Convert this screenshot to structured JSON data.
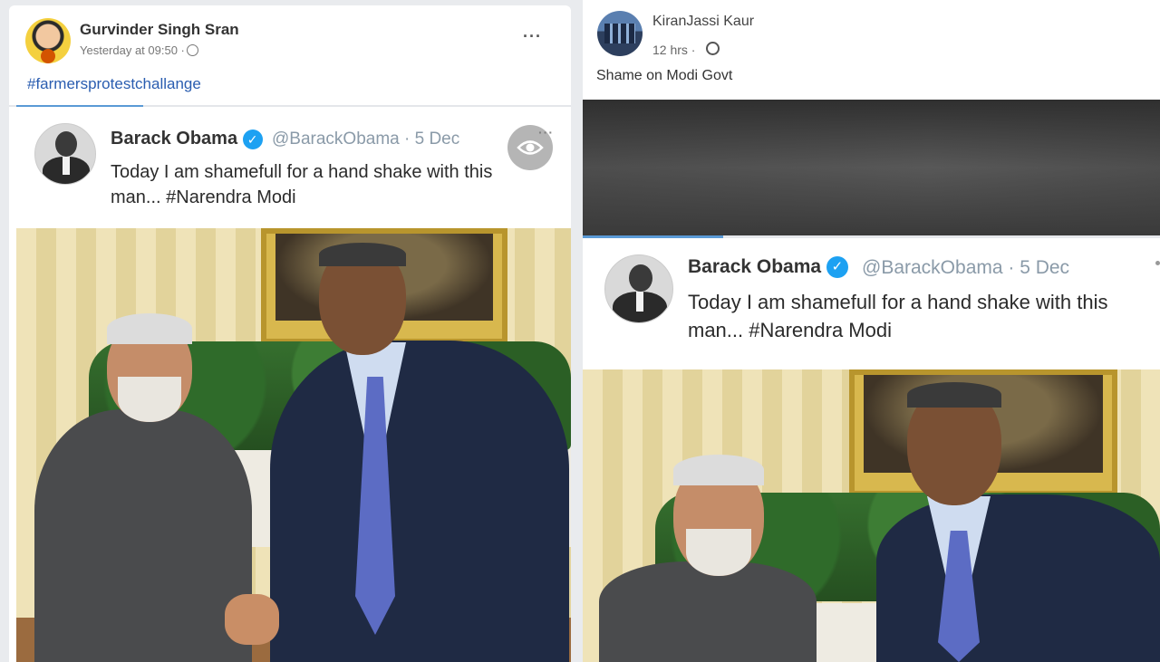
{
  "left_post": {
    "author": "Gurvinder Singh Sran",
    "timestamp": "Yesterday at 09:50 ·",
    "more": "···",
    "hashtag": "#farmersprotestchallange",
    "tweet": {
      "name": "Barack Obama",
      "verified_mark": "✓",
      "handle": "@BarackObama · 5 Dec",
      "more": "···",
      "text_line1": "Today I am shamefull for a hand shake with this",
      "text_line2": "man... #Narendra Modi"
    }
  },
  "right_post": {
    "author": "KiranJassi Kaur",
    "timestamp": "12 hrs ·",
    "text": "Shame on Modi Govt",
    "tweet": {
      "name": "Barack Obama",
      "verified_mark": "✓",
      "handle": "@BarackObama · 5 Dec",
      "text_line1": "Today I am shamefull for a hand shake with this",
      "text_line2": "man... #Narendra Modi"
    }
  },
  "colors": {
    "link": "#2a5db0",
    "verified": "#1da1f2",
    "handle": "#8a9aa8",
    "progress": "#5a9ad6"
  },
  "icons": [
    "globe-icon",
    "eye-icon",
    "more-icon",
    "verified-icon"
  ]
}
